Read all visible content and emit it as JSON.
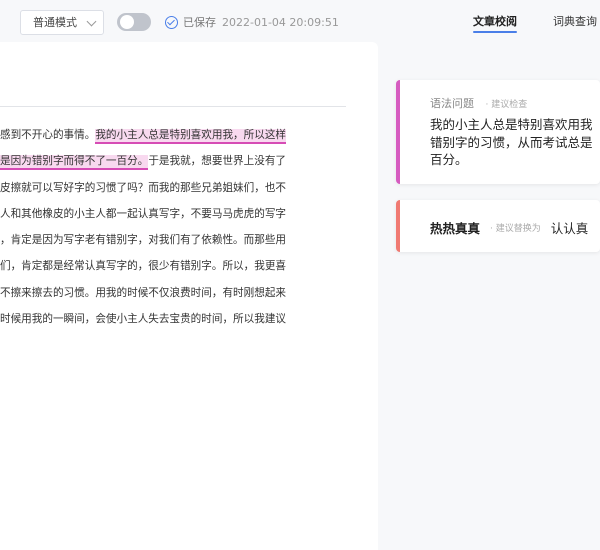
{
  "toolbar": {
    "mode_label": "普通模式",
    "saved_label": "已保存",
    "saved_time": "2022-01-04 20:09:51"
  },
  "tabs": {
    "proof": "文章校阅",
    "dict": "词典查询"
  },
  "editor": {
    "lines": [
      {
        "pre": "感到不开心的事情。",
        "hl": "我的小主人总是特别喜欢用我，所以这样",
        "post": ""
      },
      {
        "pre": "",
        "hl": "是因为错别字而得不了一百分。",
        "post": "于是我就，想要世界上没有了"
      },
      {
        "pre": "皮擦就可以写好字的习惯了吗？而我的那些兄弟姐妹们，也不",
        "hl": "",
        "post": ""
      },
      {
        "pre": "人和其他橡皮的小主人都一起认真写字，不要马马虎虎的写字",
        "hl": "",
        "post": ""
      },
      {
        "pre": "，肯定是因为写字老有错别字，对我们有了依赖性。而那些用",
        "hl": "",
        "post": ""
      },
      {
        "pre": "们，肯定都是经常认真写字的，很少有错别字。所以，我更喜",
        "hl": "",
        "post": ""
      },
      {
        "pre": "不擦来擦去的习惯。用我的时候不仅浪费时间，有时刚想起来",
        "hl": "",
        "post": ""
      },
      {
        "pre": "时候用我的一瞬间，会使小主人失去宝贵的时间，所以我建议",
        "hl": "",
        "post": ""
      }
    ]
  },
  "cards": {
    "grammar": {
      "type": "语法问题",
      "hint": "· 建议检查",
      "lines": [
        "我的小主人总是特别喜欢用我",
        "错别字的习惯，从而考试总是",
        "百分。"
      ]
    },
    "replace": {
      "wrong": "热热真真",
      "hint": "· 建议替换为",
      "right": "认认真"
    }
  },
  "colors": {
    "accent": "#4a7fe8",
    "grammar_bar": "#d65cc0",
    "replace_bar": "#f07a72",
    "highlight_bg": "#f8d9ef"
  }
}
